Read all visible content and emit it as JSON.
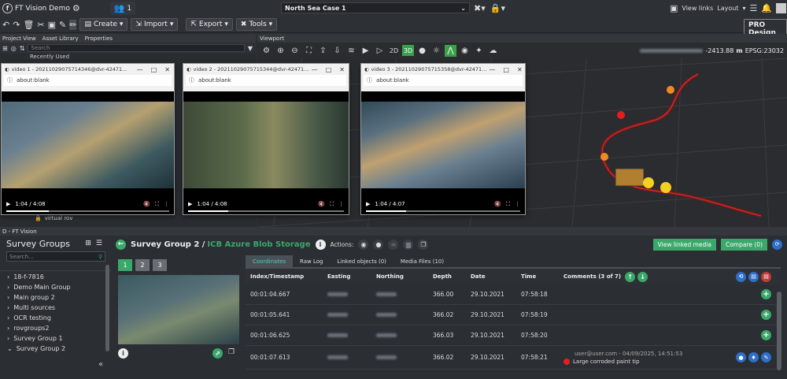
{
  "app": {
    "title": "FT Vision Demo",
    "users": "1",
    "case": "North Sea Case 1",
    "view_links": "View links",
    "layout": "Layout",
    "pro": "PRO Design"
  },
  "toolbar": {
    "create": "Create",
    "import": "Import",
    "export": "Export",
    "tools": "Tools"
  },
  "left_tabs": [
    "Project View",
    "Asset Library",
    "Properties"
  ],
  "viewport": {
    "tab": "Viewport",
    "depth": "-2413.88",
    "depth_unit": "m",
    "epsg": "EPSG:23032",
    "mode2d": "2D",
    "mode3d": "3D"
  },
  "tree": {
    "recently": "Recently Used",
    "rov": "virtual rov",
    "search": "Search"
  },
  "videos": [
    {
      "title": "video 1 - 20211029075714346@dvr-42471...",
      "url": "about:blank",
      "time": "1:04 / 4:08",
      "progress": 0.26
    },
    {
      "title": "video 2 - 20211029075715344@dvr-42471...",
      "url": "about:blank",
      "time": "1:04 / 4:08",
      "progress": 0.26
    },
    {
      "title": "video 3 - 20211029075715358@dvr-42471...",
      "url": "about:blank",
      "time": "1:04 / 4:07",
      "progress": 0.26
    }
  ],
  "bottom": {
    "panel": "D - FT Vision",
    "survey_groups": "Survey Groups",
    "search": "Search...",
    "groups": [
      "18-f-7816",
      "Demo Main Group",
      "Main group 2",
      "Multi sources",
      "OCR testing",
      "rovgroups2",
      "Survey Group 1",
      "Survey Group 2"
    ],
    "heading": "Survey Group 2 /",
    "storage": "ICB Azure Blob Storage",
    "actions": "Actions:",
    "view_linked": "View linked media",
    "compare": "Compare (0)",
    "cams": [
      "1",
      "2",
      "3"
    ],
    "tabs": [
      "Coordinates",
      "Raw Log",
      "Linked objects (0)",
      "Media Files (10)"
    ],
    "columns": [
      "Index/Timestamp",
      "Easting",
      "Northing",
      "Depth",
      "Date",
      "Time",
      "Comments (3 of 7)"
    ],
    "rows": [
      {
        "ts": "00:01:04.667",
        "depth": "366.00",
        "date": "29.10.2021",
        "time": "07:58:18"
      },
      {
        "ts": "00:01:05.641",
        "depth": "366.02",
        "date": "29.10.2021",
        "time": "07:58:19"
      },
      {
        "ts": "00:01:06.625",
        "depth": "366.03",
        "date": "29.10.2021",
        "time": "07:58:20"
      },
      {
        "ts": "00:01:07.613",
        "depth": "366.02",
        "date": "29.10.2021",
        "time": "07:58:21"
      }
    ],
    "comment_user": "user@user.com - 04/09/2025, 14:51:53",
    "comment_text": "Large corroded paint tip"
  }
}
